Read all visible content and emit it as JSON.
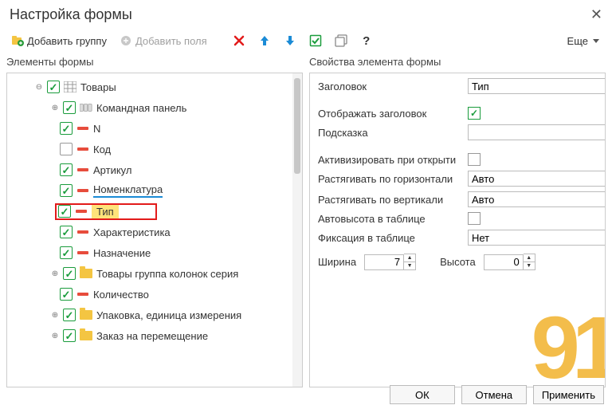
{
  "title": "Настройка формы",
  "toolbar": {
    "add_group": "Добавить группу",
    "add_fields": "Добавить поля",
    "more": "Еще"
  },
  "left_header": "Элементы формы",
  "right_header": "Свойства элемента формы",
  "tree": {
    "root": "Товары",
    "cmd": "Командная панель",
    "n": "N",
    "code": "Код",
    "article": "Артикул",
    "nomen": "Номенклатура",
    "type": "Тип",
    "char": "Характеристика",
    "assign": "Назначение",
    "group_series": "Товары группа колонок серия",
    "qty": "Количество",
    "pack": "Упаковка, единица измерения",
    "order": "Заказ на перемещение"
  },
  "props": {
    "title_lbl": "Заголовок",
    "title_val": "Тип",
    "show_title_lbl": "Отображать заголовок",
    "hint_lbl": "Подсказка",
    "hint_val": "",
    "activate_lbl": "Активизировать при открыти",
    "stretch_h_lbl": "Растягивать по горизонтали",
    "stretch_h_val": "Авто",
    "stretch_v_lbl": "Растягивать по вертикали",
    "stretch_v_val": "Авто",
    "autoheight_lbl": "Автовысота в таблице",
    "fix_lbl": "Фиксация в таблице",
    "fix_val": "Нет",
    "width_lbl": "Ширина",
    "width_val": "7",
    "height_lbl": "Высота",
    "height_val": "0"
  },
  "footer": {
    "ok": "ОК",
    "cancel": "Отмена",
    "apply": "Применить"
  }
}
